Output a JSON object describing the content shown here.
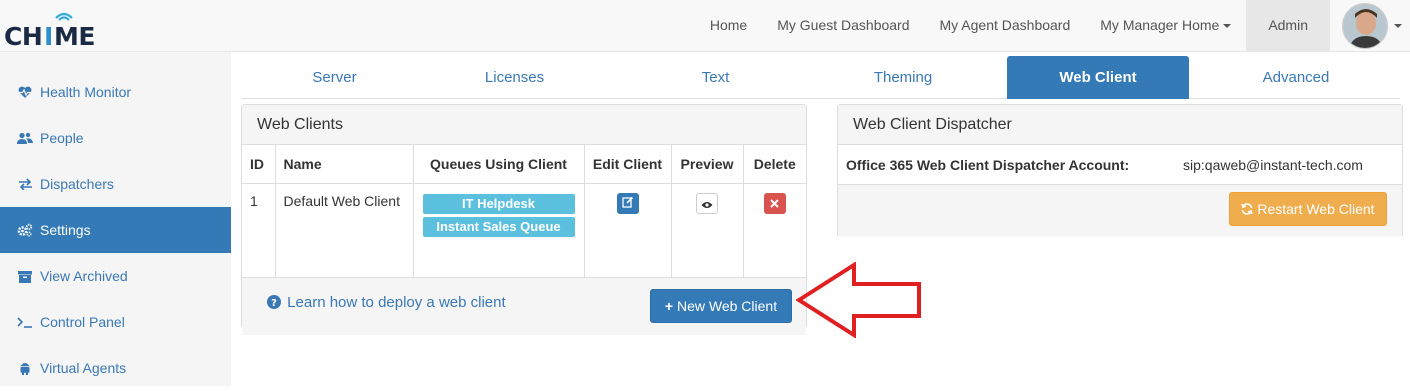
{
  "brand": {
    "logo_text": "CHIME"
  },
  "nav": {
    "links": [
      {
        "label": "Home"
      },
      {
        "label": "My Guest Dashboard"
      },
      {
        "label": "My Agent Dashboard"
      },
      {
        "label": "My Manager Home"
      },
      {
        "label": "Admin"
      }
    ]
  },
  "sidebar": {
    "items": [
      {
        "label": "Health Monitor",
        "icon": "heartbeat-icon"
      },
      {
        "label": "People",
        "icon": "users-icon"
      },
      {
        "label": "Dispatchers",
        "icon": "exchange-icon"
      },
      {
        "label": "Settings",
        "icon": "cogs-icon",
        "active": true
      },
      {
        "label": "View Archived",
        "icon": "archive-icon"
      },
      {
        "label": "Control Panel",
        "icon": "terminal-icon"
      },
      {
        "label": "Virtual Agents",
        "icon": "android-icon"
      }
    ]
  },
  "tabs": [
    {
      "label": "Server"
    },
    {
      "label": "Licenses"
    },
    {
      "label": "Text"
    },
    {
      "label": "Theming"
    },
    {
      "label": "Web Client",
      "active": true
    },
    {
      "label": "Advanced"
    }
  ],
  "web_clients": {
    "title": "Web Clients",
    "columns": [
      "ID",
      "Name",
      "Queues Using Client",
      "Edit Client",
      "Preview",
      "Delete"
    ],
    "rows": [
      {
        "id": "1",
        "name": "Default Web Client",
        "queues": [
          "IT Helpdesk",
          "Instant Sales Queue"
        ]
      }
    ],
    "learn_link": "Learn how to deploy a web client",
    "new_button": "New Web Client"
  },
  "dispatcher": {
    "title": "Web Client Dispatcher",
    "label": "Office 365 Web Client Dispatcher Account:",
    "value": "sip:qaweb@instant-tech.com",
    "restart_button": "Restart Web Client"
  },
  "colors": {
    "primary": "#337ab7",
    "info": "#5bc0de",
    "warning": "#f0ad4e",
    "danger": "#d9534f",
    "annotation_arrow": "#e02020"
  }
}
